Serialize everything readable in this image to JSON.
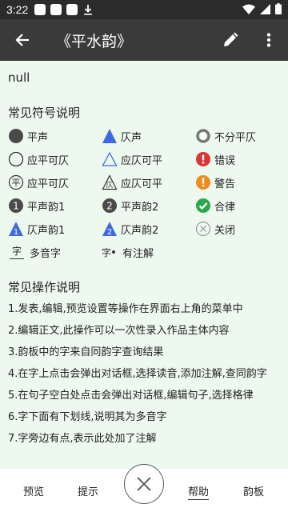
{
  "status_bar": {
    "time": "3:22"
  },
  "app_bar": {
    "title": "《平水韵》"
  },
  "content": {
    "null_text": "null",
    "symbols_title": "常见符号说明",
    "legend": [
      {
        "label": "平声",
        "icon": "filled-circle-icon"
      },
      {
        "label": "仄声",
        "icon": "filled-triangle-icon"
      },
      {
        "label": "不分平仄",
        "icon": "ring-icon"
      },
      {
        "label": "应平可仄",
        "icon": "open-circle-icon"
      },
      {
        "label": "应仄可平",
        "icon": "open-triangle-icon"
      },
      {
        "label": "错误",
        "icon": "error-icon"
      },
      {
        "label": "应平可仄",
        "icon": "circle-ping-icon"
      },
      {
        "label": "应仄可平",
        "icon": "triangle-ze-icon"
      },
      {
        "label": "警告",
        "icon": "warning-icon"
      },
      {
        "label": "平声韵1",
        "icon": "circle-1-icon"
      },
      {
        "label": "平声韵2",
        "icon": "circle-2-icon"
      },
      {
        "label": "合律",
        "icon": "check-icon"
      },
      {
        "label": "仄声韵1",
        "icon": "triangle-1-icon"
      },
      {
        "label": "仄声韵2",
        "icon": "triangle-2-icon"
      },
      {
        "label": "关闭",
        "icon": "close-circle-icon"
      },
      {
        "label": "多音字",
        "icon": "zi-underline-icon"
      },
      {
        "label": "有注解",
        "icon": "zi-dot-icon"
      }
    ],
    "icon_glyphs": {
      "ping": "平",
      "ze": "仄",
      "zi": "字",
      "one": "1",
      "two": "2",
      "exclaim": "!"
    },
    "ops_title": "常见操作说明",
    "ops": [
      "1.发表,编辑,预览设置等操作在界面右上角的菜单中",
      "2.编辑正文,此操作可以一次性录入作品主体内容",
      "3.韵板中的字来自同韵字查询结果",
      "4.在字上点击会弹出对话框,选择读音,添加注解,查同韵字",
      "5.在句子空白处点击会弹出对话框,编辑句子,选择格律",
      "6.字下面有下划线,说明其为多音字",
      "7.字旁边有点,表示此处加了注解"
    ]
  },
  "bottom_nav": {
    "preview": "预览",
    "hint": "提示",
    "help": "帮助",
    "rhyme_board": "韵板"
  },
  "colors": {
    "status_bar": "#2b2b2b",
    "app_bar": "#3a3a3a",
    "content_bg": "#edf8ef",
    "blue": "#3f68e6",
    "red": "#d93636",
    "orange": "#f08c1c",
    "green": "#2ea84a",
    "dark": "#4a4a4a"
  }
}
